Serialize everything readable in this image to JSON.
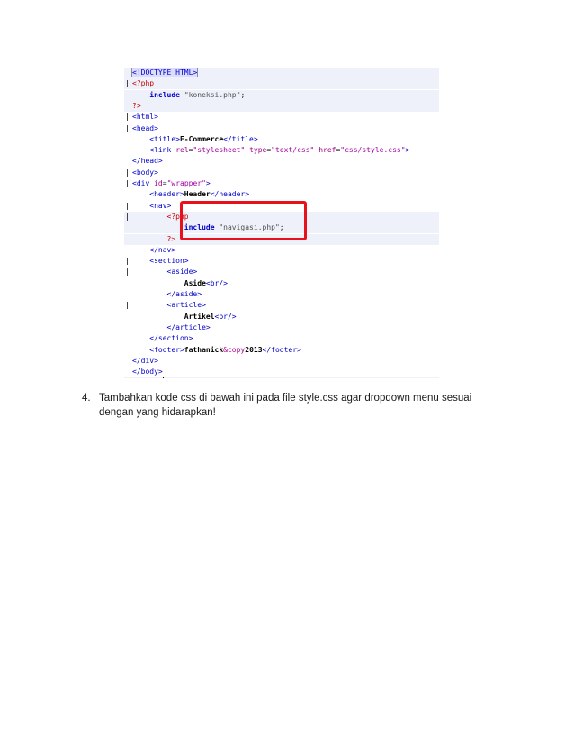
{
  "code_lines": [
    {
      "gutter": false,
      "hl": true,
      "parts": [
        {
          "c": "tag hl-box",
          "t": "<!DOCTYPE HTML>"
        }
      ]
    },
    {
      "gutter": true,
      "hl": true,
      "parts": [
        {
          "c": "php",
          "t": "<?php"
        }
      ]
    },
    {
      "gutter": false,
      "hl": true,
      "parts": [
        {
          "c": "",
          "t": "    "
        },
        {
          "c": "kw",
          "t": "include"
        },
        {
          "c": "",
          "t": " "
        },
        {
          "c": "pstr",
          "t": "\"koneksi.php\""
        },
        {
          "c": "",
          "t": ";"
        }
      ]
    },
    {
      "gutter": false,
      "hl": true,
      "parts": [
        {
          "c": "php",
          "t": "?>"
        }
      ]
    },
    {
      "gutter": true,
      "hl": false,
      "parts": [
        {
          "c": "tag",
          "t": "<html>"
        }
      ]
    },
    {
      "gutter": true,
      "hl": false,
      "parts": [
        {
          "c": "tag",
          "t": "<head>"
        }
      ]
    },
    {
      "gutter": false,
      "hl": false,
      "parts": [
        {
          "c": "",
          "t": "    "
        },
        {
          "c": "tag",
          "t": "<title>"
        },
        {
          "c": "txt",
          "t": "E-Commerce"
        },
        {
          "c": "tag",
          "t": "</title>"
        }
      ]
    },
    {
      "gutter": false,
      "hl": false,
      "parts": [
        {
          "c": "",
          "t": "    "
        },
        {
          "c": "tag",
          "t": "<link"
        },
        {
          "c": "",
          "t": " "
        },
        {
          "c": "attr",
          "t": "rel"
        },
        {
          "c": "",
          "t": "="
        },
        {
          "c": "str",
          "t": "\"stylesheet\""
        },
        {
          "c": "",
          "t": " "
        },
        {
          "c": "attr",
          "t": "type"
        },
        {
          "c": "",
          "t": "="
        },
        {
          "c": "str",
          "t": "\"text/css\""
        },
        {
          "c": "",
          "t": " "
        },
        {
          "c": "attr",
          "t": "href"
        },
        {
          "c": "",
          "t": "="
        },
        {
          "c": "str",
          "t": "\"css/style.css\""
        },
        {
          "c": "tag",
          "t": ">"
        }
      ]
    },
    {
      "gutter": false,
      "hl": false,
      "parts": [
        {
          "c": "tag",
          "t": "</head>"
        }
      ]
    },
    {
      "gutter": true,
      "hl": false,
      "parts": [
        {
          "c": "tag",
          "t": "<body>"
        }
      ]
    },
    {
      "gutter": true,
      "hl": false,
      "parts": [
        {
          "c": "tag",
          "t": "<div"
        },
        {
          "c": "",
          "t": " "
        },
        {
          "c": "attr",
          "t": "id"
        },
        {
          "c": "",
          "t": "="
        },
        {
          "c": "str",
          "t": "\"wrapper\""
        },
        {
          "c": "tag",
          "t": ">"
        }
      ]
    },
    {
      "gutter": false,
      "hl": false,
      "parts": [
        {
          "c": "",
          "t": "    "
        },
        {
          "c": "tag",
          "t": "<header>"
        },
        {
          "c": "txt",
          "t": "Header"
        },
        {
          "c": "tag",
          "t": "</header>"
        }
      ]
    },
    {
      "gutter": true,
      "hl": false,
      "parts": [
        {
          "c": "",
          "t": "    "
        },
        {
          "c": "tag",
          "t": "<nav>"
        }
      ]
    },
    {
      "gutter": true,
      "hl": true,
      "parts": [
        {
          "c": "",
          "t": "        "
        },
        {
          "c": "php",
          "t": "<?php"
        }
      ]
    },
    {
      "gutter": false,
      "hl": true,
      "parts": [
        {
          "c": "",
          "t": "            "
        },
        {
          "c": "kw",
          "t": "include"
        },
        {
          "c": "",
          "t": " "
        },
        {
          "c": "pstr",
          "t": "\"navigasi.php\""
        },
        {
          "c": "",
          "t": ";"
        }
      ]
    },
    {
      "gutter": false,
      "hl": true,
      "parts": [
        {
          "c": "",
          "t": "        "
        },
        {
          "c": "php",
          "t": "?>"
        }
      ]
    },
    {
      "gutter": false,
      "hl": false,
      "parts": [
        {
          "c": "",
          "t": "    "
        },
        {
          "c": "tag",
          "t": "</nav>"
        }
      ]
    },
    {
      "gutter": true,
      "hl": false,
      "parts": [
        {
          "c": "",
          "t": "    "
        },
        {
          "c": "tag",
          "t": "<section>"
        }
      ]
    },
    {
      "gutter": true,
      "hl": false,
      "parts": [
        {
          "c": "",
          "t": "        "
        },
        {
          "c": "tag",
          "t": "<aside>"
        }
      ]
    },
    {
      "gutter": false,
      "hl": false,
      "parts": [
        {
          "c": "",
          "t": "            "
        },
        {
          "c": "txt",
          "t": "Aside"
        },
        {
          "c": "tag",
          "t": "<br/>"
        }
      ]
    },
    {
      "gutter": false,
      "hl": false,
      "parts": [
        {
          "c": "",
          "t": "        "
        },
        {
          "c": "tag",
          "t": "</aside>"
        }
      ]
    },
    {
      "gutter": true,
      "hl": false,
      "parts": [
        {
          "c": "",
          "t": "        "
        },
        {
          "c": "tag",
          "t": "<article>"
        }
      ]
    },
    {
      "gutter": false,
      "hl": false,
      "parts": [
        {
          "c": "",
          "t": "            "
        },
        {
          "c": "txt",
          "t": "Artikel"
        },
        {
          "c": "tag",
          "t": "<br/>"
        }
      ]
    },
    {
      "gutter": false,
      "hl": false,
      "parts": [
        {
          "c": "",
          "t": "        "
        },
        {
          "c": "tag",
          "t": "</article>"
        }
      ]
    },
    {
      "gutter": false,
      "hl": false,
      "parts": [
        {
          "c": "",
          "t": "    "
        },
        {
          "c": "tag",
          "t": "</section>"
        }
      ]
    },
    {
      "gutter": false,
      "hl": false,
      "parts": [
        {
          "c": "",
          "t": "    "
        },
        {
          "c": "tag",
          "t": "<footer>"
        },
        {
          "c": "txt",
          "t": "fathanick"
        },
        {
          "c": "ent",
          "t": "&copy"
        },
        {
          "c": "txt",
          "t": "2013"
        },
        {
          "c": "tag",
          "t": "</footer>"
        }
      ]
    },
    {
      "gutter": false,
      "hl": false,
      "parts": [
        {
          "c": "tag",
          "t": "</div>"
        }
      ]
    },
    {
      "gutter": false,
      "hl": false,
      "parts": [
        {
          "c": "tag",
          "t": "</body>"
        }
      ]
    },
    {
      "gutter": false,
      "hl": true,
      "parts": [
        {
          "c": "tag",
          "t": "</html>"
        }
      ]
    }
  ],
  "instruction": {
    "number": "4.",
    "text": "Tambahkan kode css di bawah ini pada file style.css agar dropdown menu sesuai dengan yang hidarapkan!"
  },
  "colors": {
    "highlight_box": "#e8101a",
    "line_highlight": "#eef1fa",
    "tag": "#0000c8",
    "php": "#c80000"
  }
}
